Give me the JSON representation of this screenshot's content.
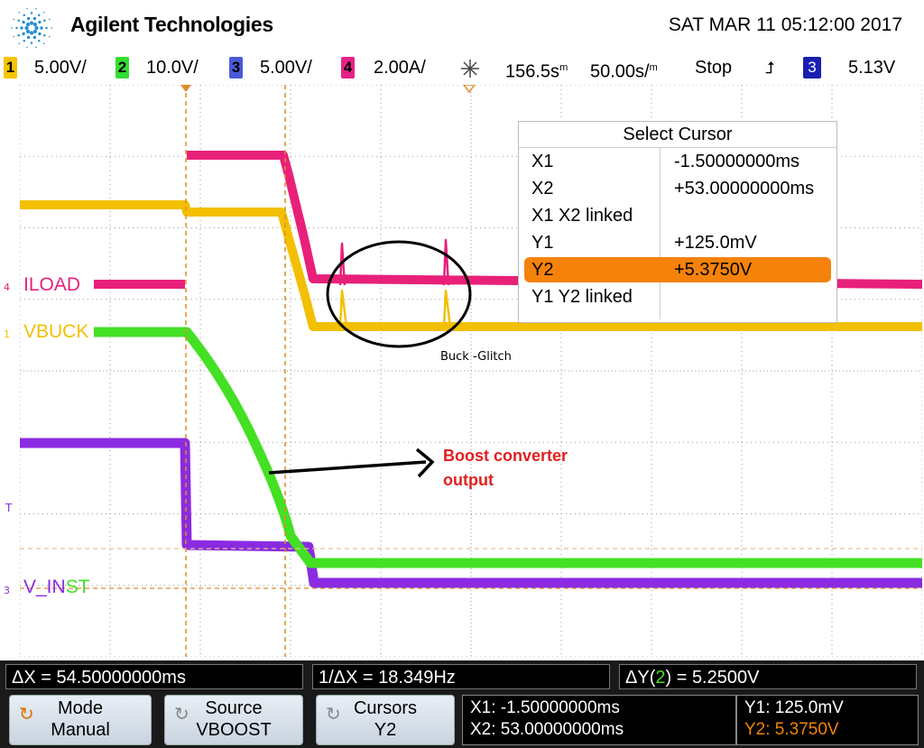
{
  "header": {
    "brand": "Agilent Technologies",
    "datetime": "SAT MAR 11 05:12:00 2017"
  },
  "status": {
    "channels": [
      {
        "num": "1",
        "scale": "5.00V/",
        "color": "#f5c400"
      },
      {
        "num": "2",
        "scale": "10.0V/",
        "color": "#33dd33"
      },
      {
        "num": "3",
        "scale": "5.00V/",
        "color": "#4a5ad8"
      },
      {
        "num": "4",
        "scale": "2.00A/",
        "color": "#e8208a"
      }
    ],
    "time_position": "156.5s",
    "time_position_unit": "m",
    "time_scale": "50.00s/",
    "time_scale_unit": "m",
    "run_state": "Stop",
    "trigger_source": "3",
    "trigger_level": "5.13V"
  },
  "channel_labels": {
    "iload": {
      "marker": "4",
      "name": "ILOAD"
    },
    "vbuck": {
      "marker": "1",
      "name": "VBUCK"
    },
    "trigger": {
      "marker": "T"
    },
    "vinst": {
      "marker": "3",
      "name_a": "V_IN",
      "name_b": "ST"
    }
  },
  "cursor_panel": {
    "title": "Select Cursor",
    "rows": [
      {
        "key": "X1",
        "value": "-1.50000000ms"
      },
      {
        "key": "X2",
        "value": "+53.00000000ms"
      },
      {
        "key": "X1 X2 linked",
        "value": ""
      },
      {
        "key": "Y1",
        "value": "+125.0mV"
      },
      {
        "key": "Y2",
        "value": "+5.3750V"
      },
      {
        "key": "Y1 Y2 linked",
        "value": ""
      }
    ],
    "selected_index": 4
  },
  "annotations": {
    "glitch": "Buck -Glitch",
    "boost_line1": "Boost converter",
    "boost_line2": "output"
  },
  "measurements": {
    "delta_x": "ΔX = 54.50000000ms",
    "inv_delta_x": "1/ΔX = 18.349Hz",
    "delta_y_prefix": "ΔY(",
    "delta_y_channel": "2",
    "delta_y_suffix": ") = 5.2500V"
  },
  "softkeys": [
    {
      "top": "Mode",
      "bottom": "Manual",
      "icon": "mode-icon"
    },
    {
      "top": "Source",
      "bottom": "VBOOST",
      "icon": "rotate-icon"
    },
    {
      "top": "Cursors",
      "bottom": "Y2",
      "icon": "rotate-icon"
    }
  ],
  "readout": {
    "x1": "X1: -1.50000000ms",
    "x2": "X2: 53.00000000ms",
    "y1": "Y1: 125.0mV",
    "y2": "Y2: 5.3750V"
  },
  "colors": {
    "iload": "#e8207a",
    "vbuck": "#f2c000",
    "vboost": "#44e024",
    "vinst": "#8a2be2",
    "cursor": "#e08a2a",
    "highlight": "#f5820a",
    "annotation_red": "#e02020"
  }
}
